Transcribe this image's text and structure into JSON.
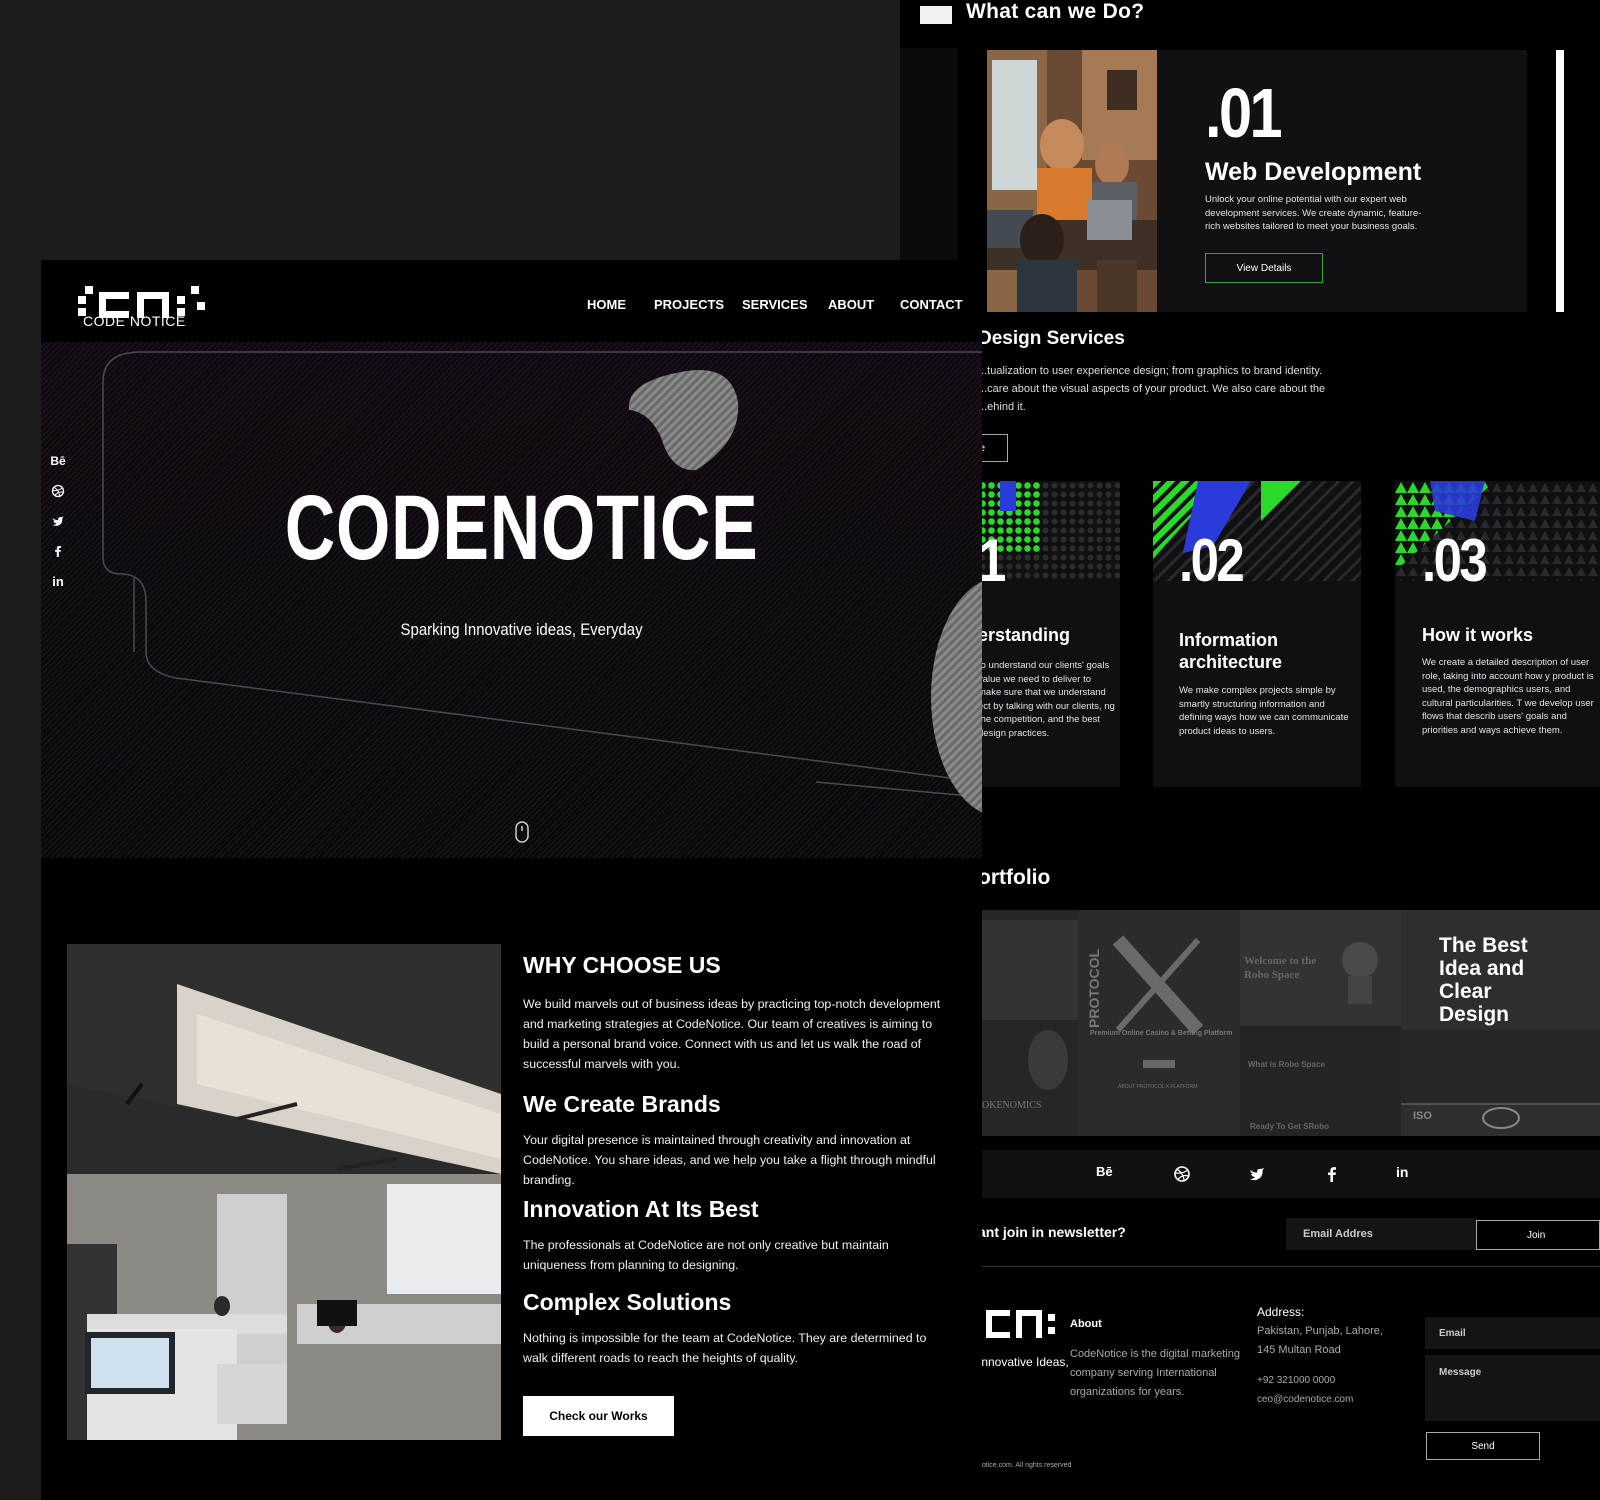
{
  "services_page": {
    "heading": "What can we Do?",
    "web": {
      "number": ".01",
      "title": "Web Development",
      "description": "Unlock your online potential with our expert web development services. We create dynamic, feature-rich websites tailored to meet your business goals.",
      "button": "View Details"
    },
    "design": {
      "title": "Design Services",
      "description": "...tualization to user experience design; from graphics to brand identity. ...care about the visual aspects of your product. We also care about the ...ehind it.",
      "button": "e"
    },
    "cards": [
      {
        "number": "1",
        "title": "erstanding",
        "description": "to understand our clients' goals value we need to deliver to make sure that we understand ect by talking with our clients, ng the competition, and the best design practices."
      },
      {
        "number": ".02",
        "title": "Information architecture",
        "description": "We make complex projects simple by smartly structuring information and defining ways how we can communicate product ideas to users."
      },
      {
        "number": ".03",
        "title": "How it works",
        "description": "We create a detailed description of user role, taking into account how y product is used, the demographics users, and cultural particularities. T we develop user flows that describ users' goals and priorities and ways achieve them."
      }
    ],
    "portfolio": {
      "title": "ortfolio",
      "tiles": [
        {
          "label": "OKENOMICS"
        },
        {
          "label": "PROTOCOL",
          "caption": "Premium Online Casino & Betting Platform",
          "sub": "ABOUT PROTOCOL X PLATFORM"
        },
        {
          "label": "Welcome to the Robo Space",
          "caption": "What is Robo Space",
          "sub": "Ready To Get SRobo"
        },
        {
          "label": "The Best Idea and Clear Design",
          "badge": "ISO"
        }
      ]
    },
    "social": [
      "Bē",
      "dribbble",
      "twitter",
      "facebook",
      "in"
    ],
    "newsletter": {
      "question": "ant join in newsletter?",
      "placeholder": "Email Addres",
      "button": "Join"
    },
    "footer": {
      "tagline": "Innovative Ideas,",
      "about_title": "About",
      "about_text": "CodeNotice is the digital marketing company serving International organizations for years.",
      "address_title": "Address:",
      "address": "Pakistan, Punjab, Lahore, 145 Multan Road",
      "phone": "+92 321000 0000",
      "email": "ceo@codenotice.com",
      "form_email": "Email",
      "form_message": "Message",
      "form_send": "Send",
      "copyright": "notice.com. All rights reserved"
    }
  },
  "home_page": {
    "logo_text": "CODE NOTICE",
    "nav": [
      "HOME",
      "PROJECTS",
      "SERVICES",
      "ABOUT",
      "CONTACT"
    ],
    "hero": {
      "title": "CODENOTICE",
      "subtitle": "Sparking Innovative ideas, Everyday"
    },
    "side_social": [
      "Bē",
      "dribbble",
      "twitter",
      "facebook",
      "in"
    ],
    "why": [
      {
        "title": "WHY CHOOSE US",
        "text": "We build marvels out of business ideas by practicing top-notch development and marketing strategies at CodeNotice. Our team of creatives is aiming to build a personal brand voice. Connect with us and let us walk the road of successful marvels with you."
      },
      {
        "title": "We Create Brands",
        "text": "Your digital presence is maintained through creativity and innovation at CodeNotice. You share ideas, and we help you take a flight through mindful branding."
      },
      {
        "title": "Innovation At Its Best",
        "text": "The professionals at CodeNotice are not only creative but maintain uniqueness from planning to designing."
      },
      {
        "title": "Complex Solutions",
        "text": "Nothing is impossible for the team at CodeNotice. They are determined to walk different roads to reach the heights of quality."
      }
    ],
    "cta": "Check our Works"
  },
  "colors": {
    "background": "#000000",
    "accent_green": "#27a745",
    "pattern_green": "#2bd92b",
    "pattern_blue": "#2a3bd9"
  }
}
